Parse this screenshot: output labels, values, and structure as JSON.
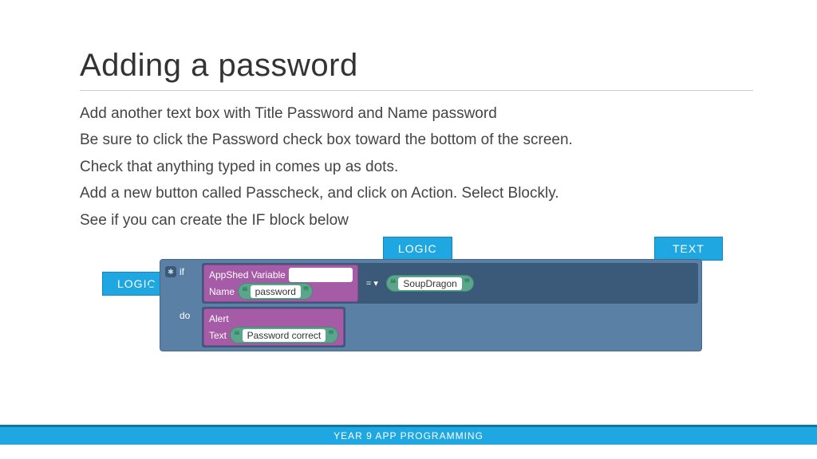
{
  "title": "Adding a password",
  "paragraphs": [
    "Add another text box with Title Password and Name password",
    "Be sure to click the Password check box toward the bottom of the screen.",
    "Check that anything typed in comes up as dots.",
    "Add a new button called Passcheck, and click on Action. Select Blockly.",
    "See if you can create the IF block below"
  ],
  "callouts": {
    "logic_top": "LOGIC",
    "text_top": "TEXT",
    "logic_left": "LOGIC"
  },
  "blockly": {
    "if_keyword": "if",
    "do_keyword": "do",
    "appshed_var_line1": "AppShed Variable",
    "appshed_var_line2": "Name",
    "name_value": "password",
    "operator": "= ▾",
    "compare_value": "SoupDragon",
    "alert_line1": "Alert",
    "alert_line2": "Text",
    "alert_value": "Password correct"
  },
  "footer": "YEAR 9 APP PROGRAMMING"
}
